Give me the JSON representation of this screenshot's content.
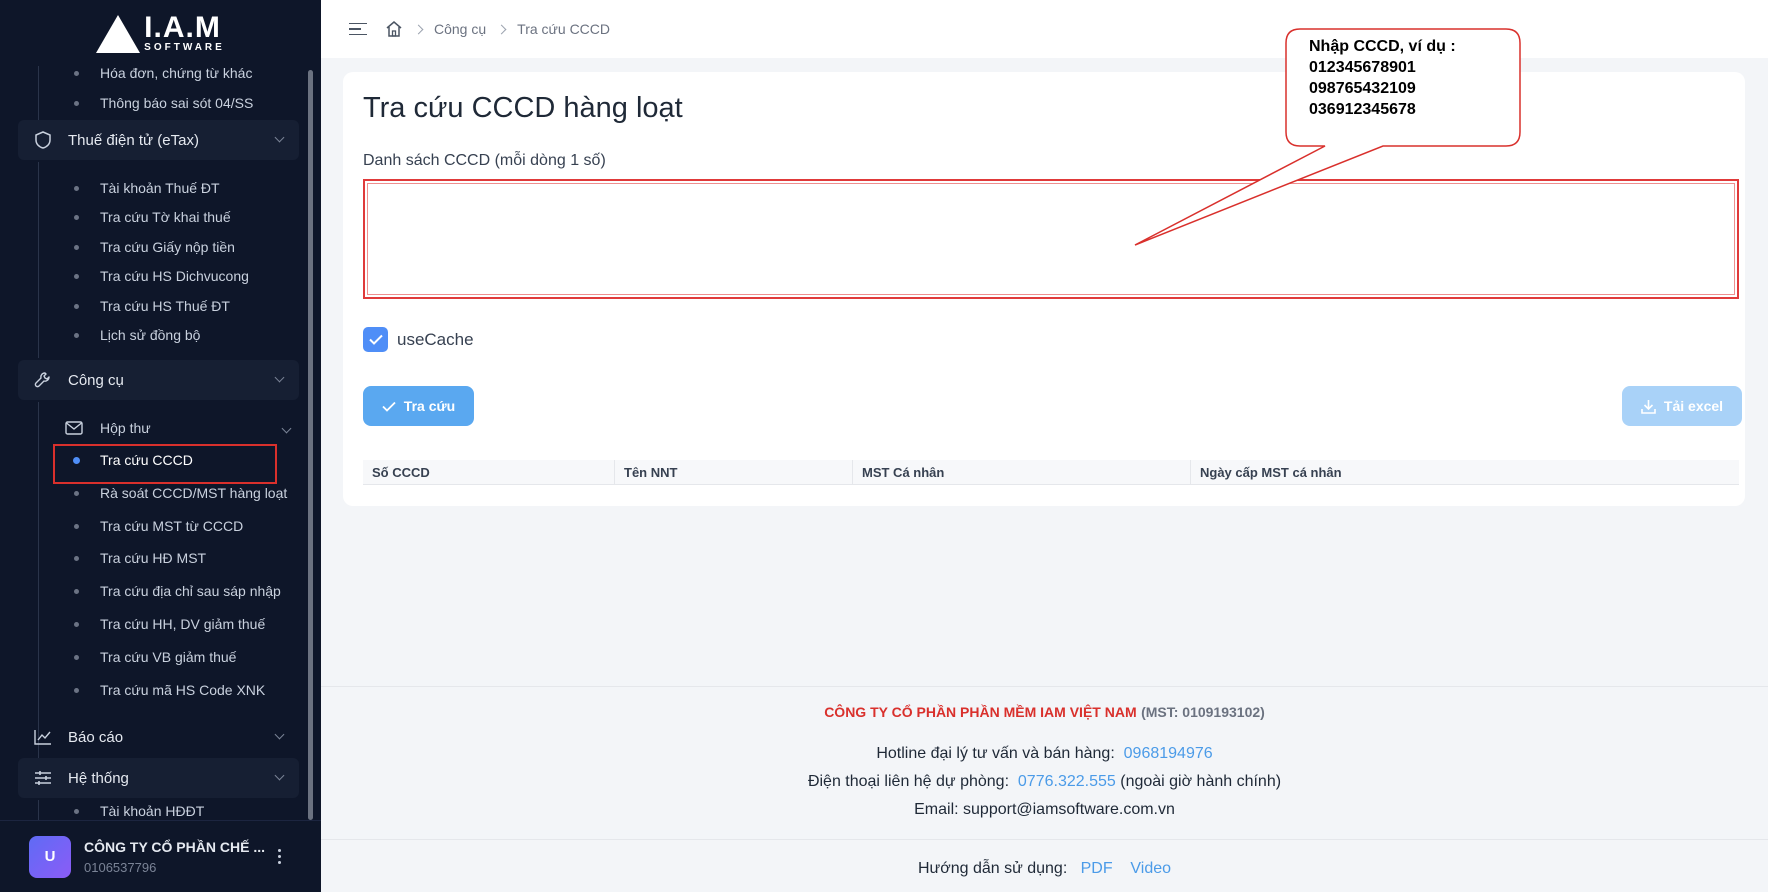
{
  "brand": {
    "logo_main": "I.A.M",
    "logo_sub": "SOFTWARE"
  },
  "sidebar": {
    "top_items": [
      "Hóa đơn, chứng từ khác",
      "Thông báo sai sót 04/SS"
    ],
    "etax": {
      "label": "Thuế điện tử (eTax)",
      "items": [
        "Tài khoản Thuế ĐT",
        "Tra cứu Tờ khai thuế",
        "Tra cứu Giấy nộp tiền",
        "Tra cứu HS Dichvucong",
        "Tra cứu HS Thuế ĐT",
        "Lịch sử đồng bộ"
      ]
    },
    "tools": {
      "label": "Công cụ",
      "mailbox": "Hộp thư",
      "items": [
        "Tra cứu CCCD",
        "Rà soát CCCD/MST hàng loạt",
        "Tra cứu MST từ CCCD",
        "Tra cứu HĐ MST",
        "Tra cứu địa chỉ sau sáp nhập",
        "Tra cứu HH, DV giảm thuế",
        "Tra cứu VB giảm thuế",
        "Tra cứu mã HS Code XNK"
      ]
    },
    "reports": {
      "label": "Báo cáo"
    },
    "system": {
      "label": "Hệ thống",
      "items": [
        "Tài khoản HĐĐT"
      ]
    },
    "user": {
      "initial": "U",
      "name": "CÔNG TY CỔ PHẦN CHẾ ...",
      "mst": "0106537796"
    }
  },
  "breadcrumb": {
    "level1": "Công cụ",
    "level2": "Tra cứu CCCD"
  },
  "main": {
    "title": "Tra cứu CCCD hàng loạt",
    "field_label": "Danh sách CCCD (mỗi dòng 1 số)",
    "textarea_value": "",
    "use_cache_label": "useCache",
    "use_cache_checked": true,
    "search_button": "Tra cứu",
    "excel_button": "Tải excel",
    "table_headers": [
      "Số CCCD",
      "Tên NNT",
      "MST Cá nhân",
      "Ngày cấp MST cá nhân"
    ]
  },
  "callout": {
    "title": "Nhập CCCD, ví dụ :",
    "lines": [
      "012345678901",
      "098765432109",
      "036912345678"
    ]
  },
  "footer": {
    "company": "CÔNG TY CỔ PHẦN PHẦN MỀM IAM VIỆT NAM",
    "company_mst": "(MST: 0109193102)",
    "hotline_label": "Hotline đại lý tư vấn và bán hàng:",
    "hotline": "0968194976",
    "backup_label": "Điện thoại liên hệ dự phòng:",
    "backup_phone": "0776.322.555",
    "backup_note": "(ngoài giờ hành chính)",
    "email_label": "Email:",
    "email": "support@iamsoftware.com.vn",
    "guide_label": "Hướng dẫn sử dụng:",
    "guide_pdf": "PDF",
    "guide_video": "Video"
  },
  "colors": {
    "accent": "#4f8ef7",
    "danger": "#d9302c",
    "sidebar_bg": "#0e1629"
  }
}
